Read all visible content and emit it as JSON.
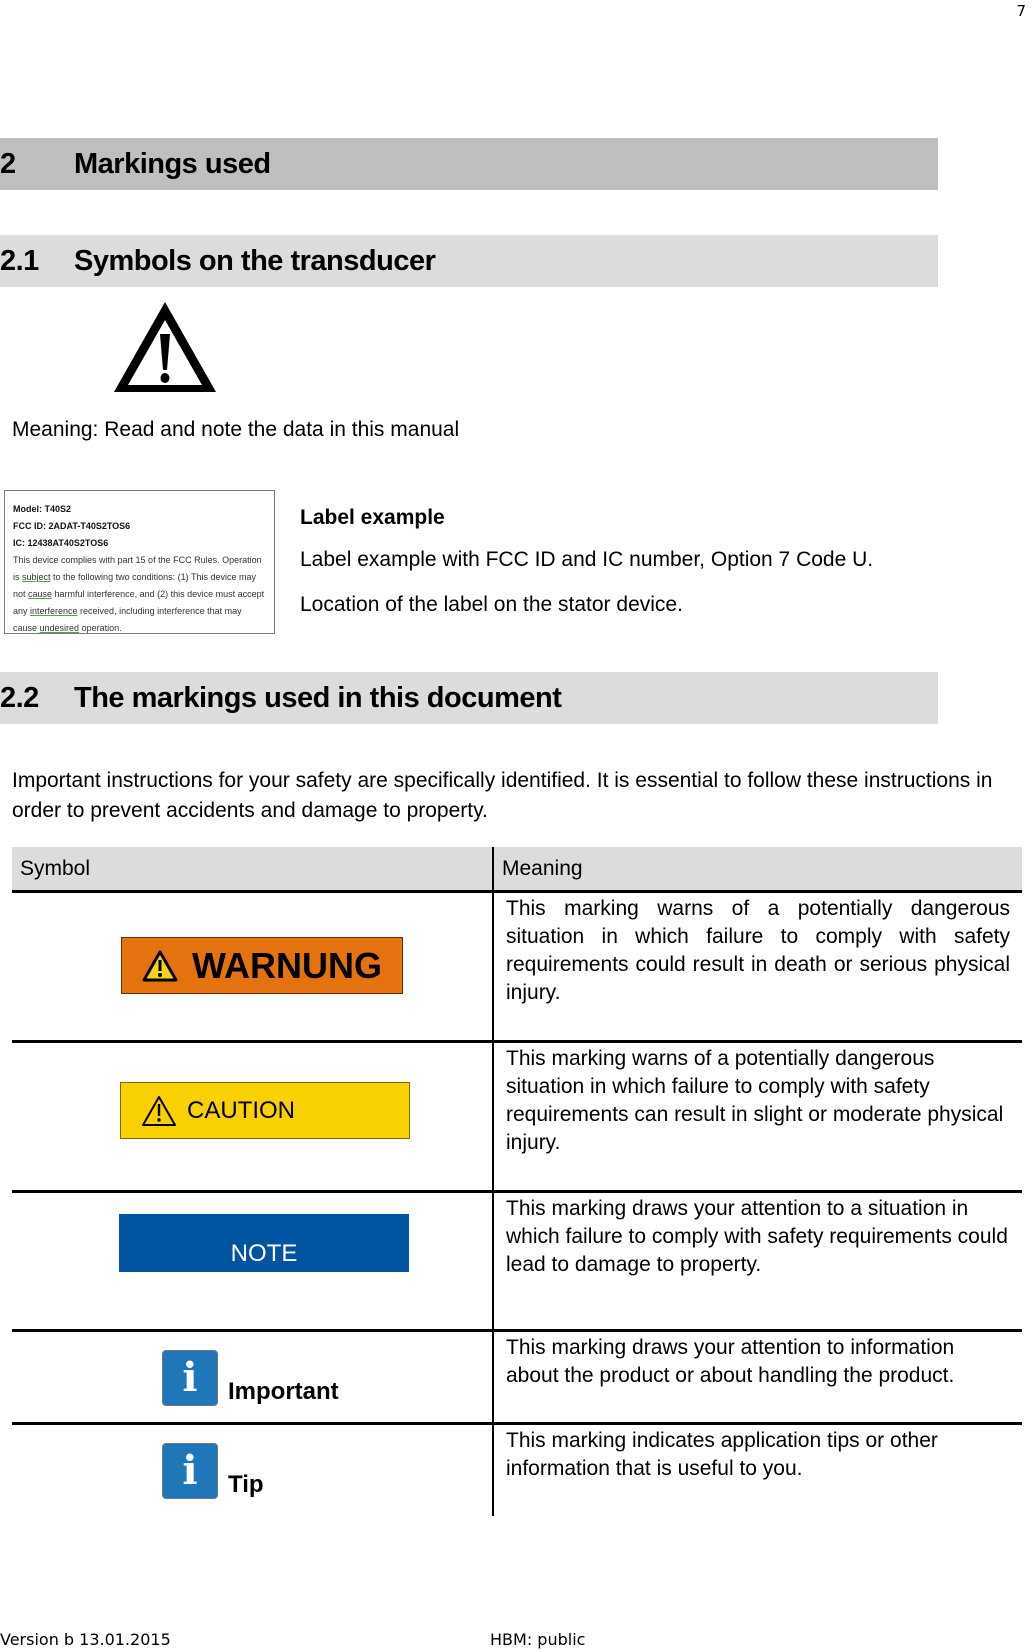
{
  "page_number": "7",
  "heading1": {
    "number": "2",
    "title": "Markings used"
  },
  "section21": {
    "heading": {
      "number": "2.1",
      "title": "Symbols on the transducer"
    },
    "symbol_icon": "warning-triangle-icon",
    "meaning": "Meaning: Read and note the data in this manual",
    "label_image": {
      "lines": [
        "Model: T40S2",
        "FCC ID: 2ADAT-T40S2TOS6",
        "IC: 12438AT40S2TOS6"
      ],
      "compliance": {
        "p1": "This device complies with part 15 of the FCC Rules. Operation is ",
        "w_subject": "subject",
        "p2": " to the following two conditions: (1) This device may not ",
        "w_cause": "cause",
        "p3": " harmful interference, and (2) this device must accept any ",
        "w_interference": "interference",
        "p4": " received, including interference that may cause ",
        "w_undesired": "undesired",
        "p5": " operation."
      }
    },
    "label_title": "Label example",
    "label_desc1": "Label example with FCC ID and IC number, Option 7 Code U.",
    "label_desc2": "Location of the label on the stator device."
  },
  "section22": {
    "heading": {
      "number": "2.2",
      "title": "The markings used in this document"
    },
    "intro": "Important instructions for your safety are specifically identified. It is essential to follow these instructions in order to prevent accidents and damage to property.",
    "table": {
      "headers": [
        "Symbol",
        "Meaning"
      ],
      "rows": [
        {
          "symbol": "WARNUNG",
          "icon": "warning-triangle-icon",
          "color": "#e4730f",
          "meaning": "This marking warns of a potentially dangerous situation in which failure to comply with safety requirements could result in death or serious physical injury."
        },
        {
          "symbol": "CAUTION",
          "icon": "warning-triangle-icon",
          "color": "#fad100",
          "meaning": "This marking warns of a potentially dangerous situation in which failure to comply with safety requirements can result in slight or moderate physical injury."
        },
        {
          "symbol": "NOTE",
          "color": "#0054a1",
          "meaning": "This marking draws your attention to a situation in which failure to comply with safety requirements could lead to damage to property."
        },
        {
          "symbol": "Important",
          "icon": "info-icon",
          "color": "#1f76b8",
          "meaning": "This marking draws your attention to information about the product or about handling the product."
        },
        {
          "symbol": "Tip",
          "icon": "info-icon",
          "color": "#1f76b8",
          "meaning": "This marking indicates application tips or other information that is useful to you."
        }
      ]
    }
  },
  "footer": {
    "version": "Version b 13.01.2015",
    "classification": "HBM: public"
  }
}
